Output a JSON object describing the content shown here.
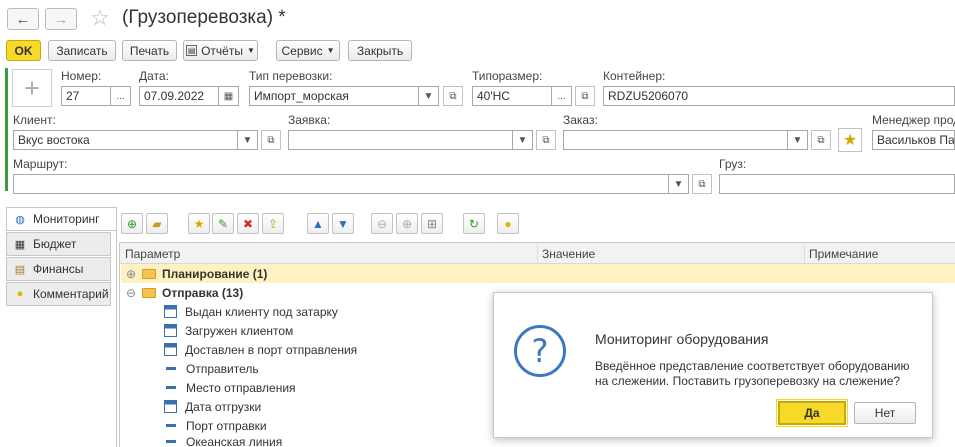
{
  "window": {
    "title": "(Грузоперевозка) *"
  },
  "toolbar": {
    "ok": "OK",
    "save": "Записать",
    "print": "Печать",
    "reports": "Отчёты",
    "service": "Сервис",
    "close": "Закрыть"
  },
  "form": {
    "number": {
      "label": "Номер:",
      "value": "27"
    },
    "date": {
      "label": "Дата:",
      "value": "07.09.2022"
    },
    "transport_type": {
      "label": "Тип перевозки:",
      "value": "Импорт_морская"
    },
    "size": {
      "label": "Типоразмер:",
      "value": "40'HC"
    },
    "container": {
      "label": "Контейнер:",
      "value": "RDZU5206070"
    },
    "client": {
      "label": "Клиент:",
      "value": "Вкус востока"
    },
    "request": {
      "label": "Заявка:",
      "value": ""
    },
    "order": {
      "label": "Заказ:",
      "value": ""
    },
    "manager": {
      "label": "Менеджер прода",
      "value": "Васильков Павел"
    },
    "route": {
      "label": "Маршрут:",
      "value": ""
    },
    "cargo": {
      "label": "Груз:",
      "value": ""
    }
  },
  "tabs": [
    "Мониторинг",
    "Бюджет",
    "Финансы",
    "Комментарий"
  ],
  "table": {
    "columns": [
      "Параметр",
      "Значение",
      "Примечание"
    ],
    "rows": [
      {
        "label": "Планирование (1)",
        "type": "group",
        "expanded": false
      },
      {
        "label": "Отправка (13)",
        "type": "group",
        "expanded": true
      },
      {
        "label": "Выдан клиенту под затарку",
        "type": "date"
      },
      {
        "label": "Загружен клиентом",
        "type": "date"
      },
      {
        "label": "Доставлен в порт отправления",
        "type": "date"
      },
      {
        "label": "Отправитель",
        "type": "ref"
      },
      {
        "label": "Место отправления",
        "type": "ref"
      },
      {
        "label": "Дата отгрузки",
        "type": "date"
      },
      {
        "label": "Порт отправки",
        "type": "ref"
      },
      {
        "label": "Океанская линия",
        "type": "ref"
      }
    ]
  },
  "dialog": {
    "title": "Мониторинг оборудования",
    "message": "Введённое представление соответствует оборудованию на слежении. Поставить грузоперевозку на слежение?",
    "yes": "Да",
    "no": "Нет"
  },
  "colors": {
    "accent": "#f7d92a",
    "group_highlight": "#fff2c2",
    "link_blue": "#3b6fb0",
    "green_bar": "#3c9b3c"
  }
}
